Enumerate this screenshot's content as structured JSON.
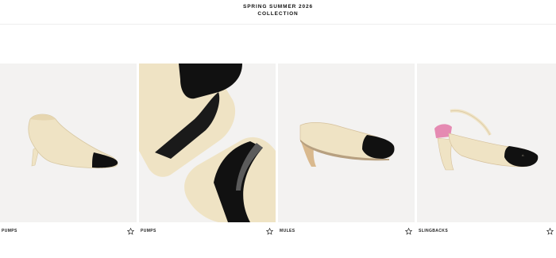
{
  "header": {
    "line1": "SPRING SUMMER 2026",
    "line2": "COLLECTION"
  },
  "products": [
    {
      "category": "PUMPS",
      "icon": "star-outline-icon"
    },
    {
      "category": "PUMPS",
      "icon": "star-outline-icon"
    },
    {
      "category": "MULES",
      "icon": "star-outline-icon"
    },
    {
      "category": "SLINGBACKS",
      "icon": "star-outline-icon"
    }
  ],
  "colors": {
    "cream": "#efe3c4",
    "black_patent": "#111111",
    "pink_lining": "#e58ab2",
    "tan_heel": "#d9b98e",
    "image_bg": "#f3f2f1"
  }
}
